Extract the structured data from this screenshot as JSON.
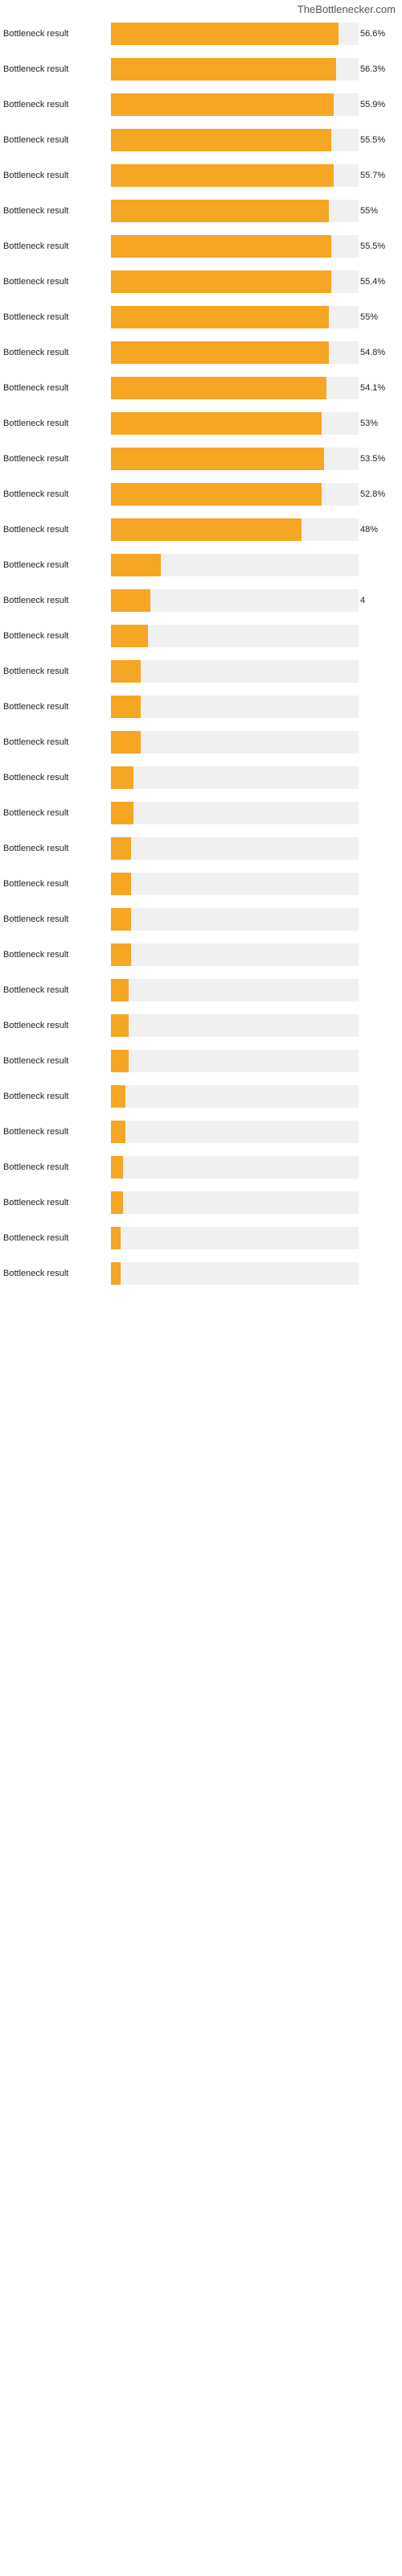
{
  "site": {
    "title": "TheBottlenecker.com"
  },
  "bars": [
    {
      "label": "Bottleneck result",
      "value": 56.6,
      "display": "56.6%",
      "width": 92
    },
    {
      "label": "Bottleneck result",
      "value": 56.3,
      "display": "56.3%",
      "width": 91
    },
    {
      "label": "Bottleneck result",
      "value": 55.9,
      "display": "55.9%",
      "width": 90
    },
    {
      "label": "Bottleneck result",
      "value": 55.5,
      "display": "55.5%",
      "width": 89
    },
    {
      "label": "Bottleneck result",
      "value": 55.7,
      "display": "55.7%",
      "width": 90
    },
    {
      "label": "Bottleneck result",
      "value": 55.0,
      "display": "55%",
      "width": 88
    },
    {
      "label": "Bottleneck result",
      "value": 55.5,
      "display": "55.5%",
      "width": 89
    },
    {
      "label": "Bottleneck result",
      "value": 55.4,
      "display": "55.4%",
      "width": 89
    },
    {
      "label": "Bottleneck result",
      "value": 55.0,
      "display": "55%",
      "width": 88
    },
    {
      "label": "Bottleneck result",
      "value": 54.8,
      "display": "54.8%",
      "width": 88
    },
    {
      "label": "Bottleneck result",
      "value": 54.1,
      "display": "54.1%",
      "width": 87
    },
    {
      "label": "Bottleneck result",
      "value": 53.0,
      "display": "53%",
      "width": 85
    },
    {
      "label": "Bottleneck result",
      "value": 53.5,
      "display": "53.5%",
      "width": 86
    },
    {
      "label": "Bottleneck result",
      "value": 52.8,
      "display": "52.8%",
      "width": 85
    },
    {
      "label": "Bottleneck result",
      "value": 48.0,
      "display": "48%",
      "width": 77
    },
    {
      "label": "Bottleneck result",
      "value": 5,
      "display": "",
      "width": 20
    },
    {
      "label": "Bottleneck result",
      "value": 4,
      "display": "4",
      "width": 16
    },
    {
      "label": "Bottleneck result",
      "value": 4,
      "display": "",
      "width": 15
    },
    {
      "label": "Bottleneck result",
      "value": 3,
      "display": "",
      "width": 12
    },
    {
      "label": "Bottleneck result",
      "value": 3,
      "display": "",
      "width": 12
    },
    {
      "label": "Bottleneck result",
      "value": 3,
      "display": "",
      "width": 12
    },
    {
      "label": "Bottleneck result",
      "value": 2,
      "display": "",
      "width": 9
    },
    {
      "label": "Bottleneck result",
      "value": 2,
      "display": "",
      "width": 9
    },
    {
      "label": "Bottleneck result",
      "value": 2,
      "display": "",
      "width": 8
    },
    {
      "label": "Bottleneck result",
      "value": 2,
      "display": "",
      "width": 8
    },
    {
      "label": "Bottleneck result",
      "value": 2,
      "display": "",
      "width": 8
    },
    {
      "label": "Bottleneck result",
      "value": 2,
      "display": "",
      "width": 8
    },
    {
      "label": "Bottleneck result",
      "value": 2,
      "display": "",
      "width": 7
    },
    {
      "label": "Bottleneck result",
      "value": 2,
      "display": "",
      "width": 7
    },
    {
      "label": "Bottleneck result",
      "value": 2,
      "display": "",
      "width": 7
    },
    {
      "label": "Bottleneck result",
      "value": 1,
      "display": "",
      "width": 6
    },
    {
      "label": "Bottleneck result",
      "value": 1,
      "display": "",
      "width": 6
    },
    {
      "label": "Bottleneck result",
      "value": 1,
      "display": "",
      "width": 5
    },
    {
      "label": "Bottleneck result",
      "value": 1,
      "display": "",
      "width": 5
    },
    {
      "label": "Bottleneck result",
      "value": 1,
      "display": "",
      "width": 4
    },
    {
      "label": "Bottleneck result",
      "value": 1,
      "display": "",
      "width": 4
    }
  ],
  "bar_colors": {
    "primary": "#f5a623"
  }
}
